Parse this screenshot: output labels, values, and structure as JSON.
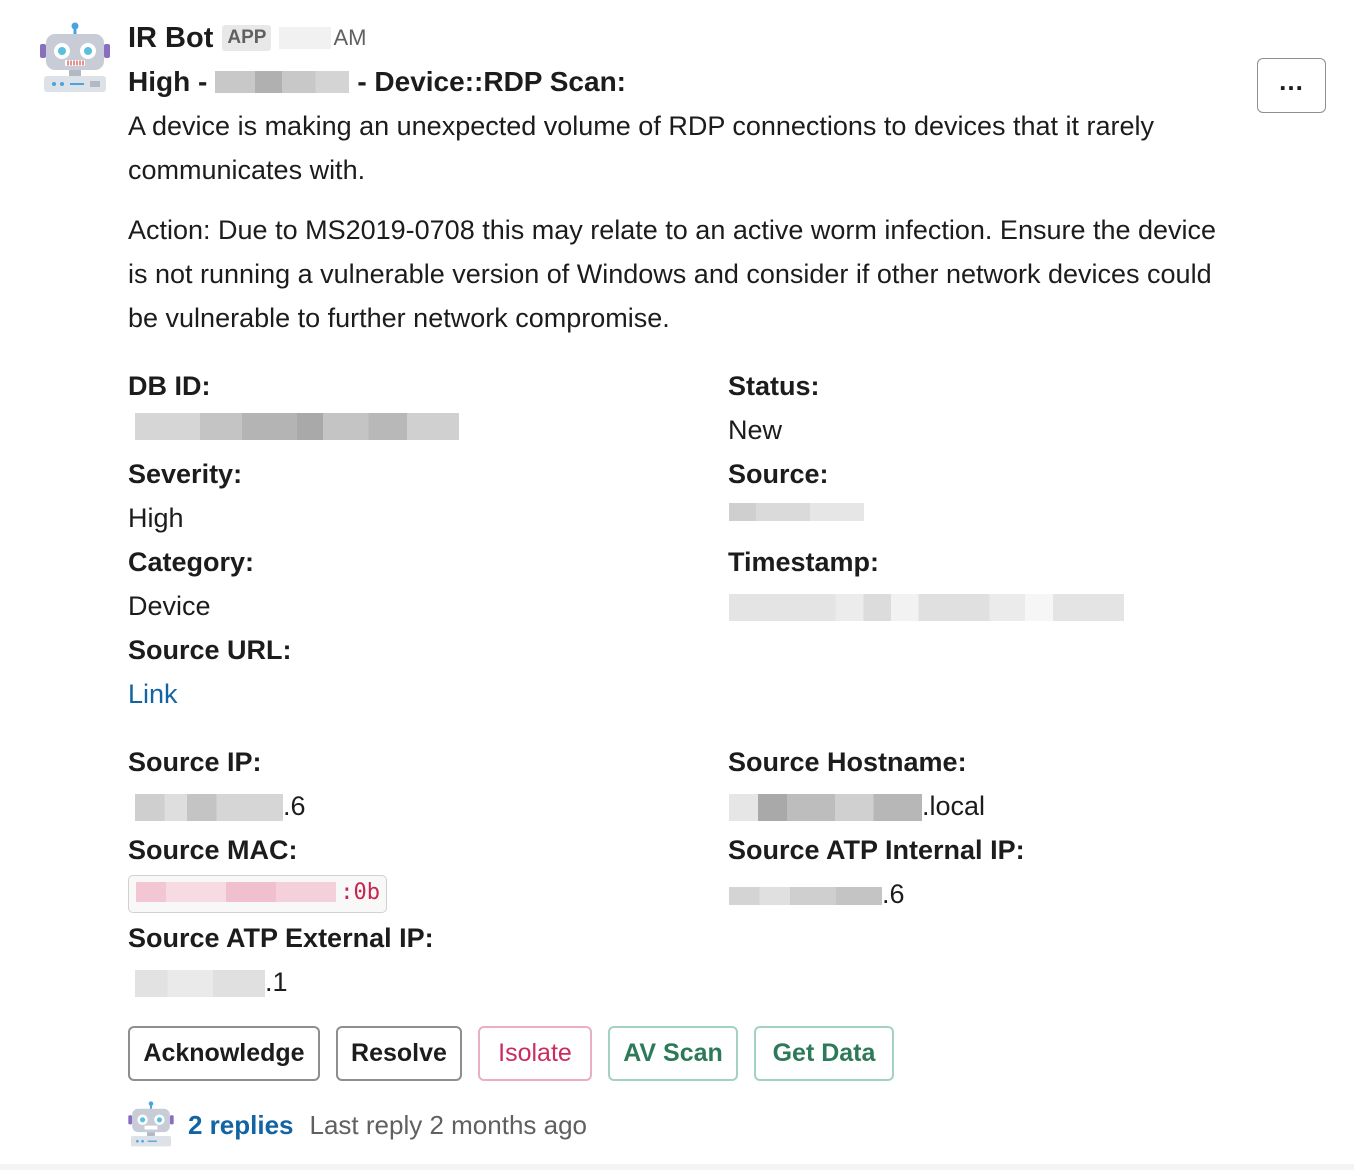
{
  "message": {
    "bot_name": "IR Bot",
    "app_badge": "APP",
    "time": "AM",
    "title_prefix": "High -",
    "title_suffix": "- Device::RDP Scan:",
    "description": "A device is making an unexpected volume of RDP connections to devices that it rarely communicates with.",
    "action": "Action: Due to MS2019-0708 this may relate to an active worm infection. Ensure the device is not running a vulnerable version of Windows and consider if other network devices could be vulnerable to further network compromise."
  },
  "more_button": {
    "label": "..."
  },
  "fields": {
    "db_id": {
      "label": "DB ID:"
    },
    "status": {
      "label": "Status:",
      "value": "New"
    },
    "severity": {
      "label": "Severity:",
      "value": "High"
    },
    "source": {
      "label": "Source:"
    },
    "category": {
      "label": "Category:",
      "value": "Device"
    },
    "timestamp": {
      "label": "Timestamp:"
    },
    "source_url": {
      "label": "Source URL:",
      "value": "Link"
    },
    "source_ip": {
      "label": "Source IP:",
      "suffix": ".6"
    },
    "source_hostname": {
      "label": "Source Hostname:",
      "suffix": ".local"
    },
    "source_mac": {
      "label": "Source MAC:",
      "suffix": ":0b"
    },
    "atp_internal_ip": {
      "label": "Source ATP Internal IP:",
      "suffix": ".6"
    },
    "atp_external_ip": {
      "label": "Source ATP External IP:",
      "suffix": ".1"
    }
  },
  "actions": {
    "acknowledge": "Acknowledge",
    "resolve": "Resolve",
    "isolate": "Isolate",
    "av_scan": "AV Scan",
    "get_data": "Get Data"
  },
  "thread": {
    "count": "2 replies",
    "last_reply": "Last reply 2 months ago"
  },
  "colors": {
    "link": "#1264a3",
    "danger": "#cc2b5e",
    "primary": "#2c7a5a",
    "code": "#c7254e"
  },
  "icons": [
    "robot-avatar-icon",
    "more-actions-icon"
  ]
}
